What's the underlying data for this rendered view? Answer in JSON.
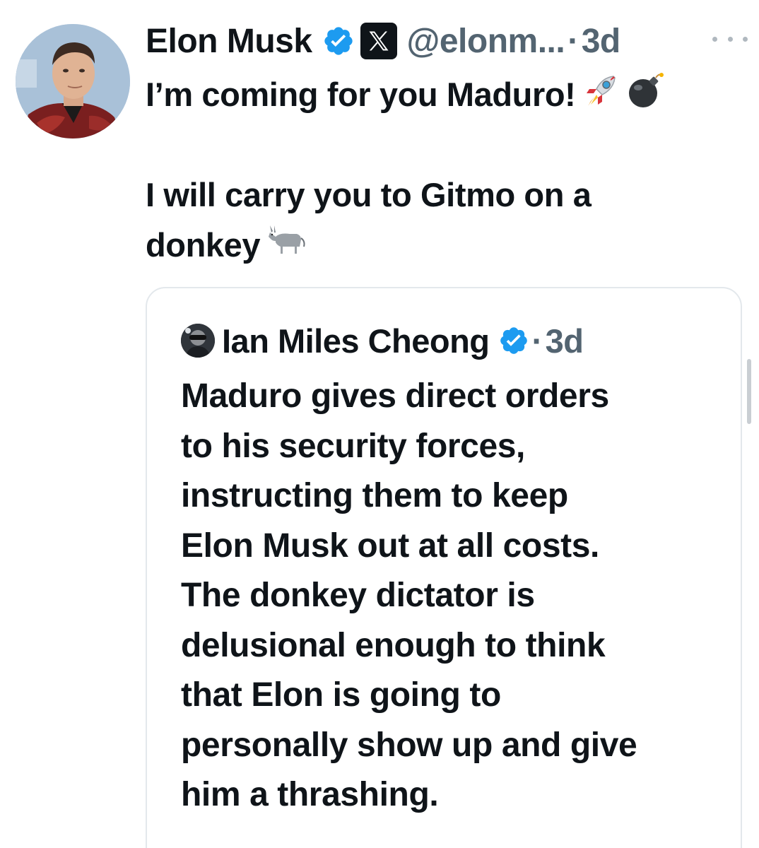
{
  "post": {
    "author": {
      "display_name": "Elon Musk",
      "handle": "@elonm...",
      "separator": "·",
      "time": "3d",
      "verified_icon": "verified-badge-icon",
      "affiliation_icon": "x-logo-icon"
    },
    "more_icon": "more-options-icon",
    "text_lines": [
      "I’m coming for you Maduro!",
      "",
      "I will carry you to Gitmo on a",
      "donkey"
    ],
    "emojis": [
      "rocket-emoji",
      "bomb-emoji",
      "donkey-emoji"
    ],
    "quote": {
      "author": {
        "display_name": "Ian Miles Cheong",
        "separator": "·",
        "time": "3d",
        "verified_icon": "verified-badge-icon"
      },
      "text_lines": [
        "Maduro gives direct orders",
        "to his security forces,",
        "instructing them to keep",
        "Elon Musk out at all costs.",
        "The donkey dictator is",
        "delusional enough to think",
        "that Elon is going to",
        "personally show up and give",
        "him a thrashing."
      ]
    }
  },
  "colors": {
    "text": "#0f1419",
    "secondary": "#536471",
    "verified_blue": "#1d9bf0",
    "card_border": "#e3e8ec"
  }
}
